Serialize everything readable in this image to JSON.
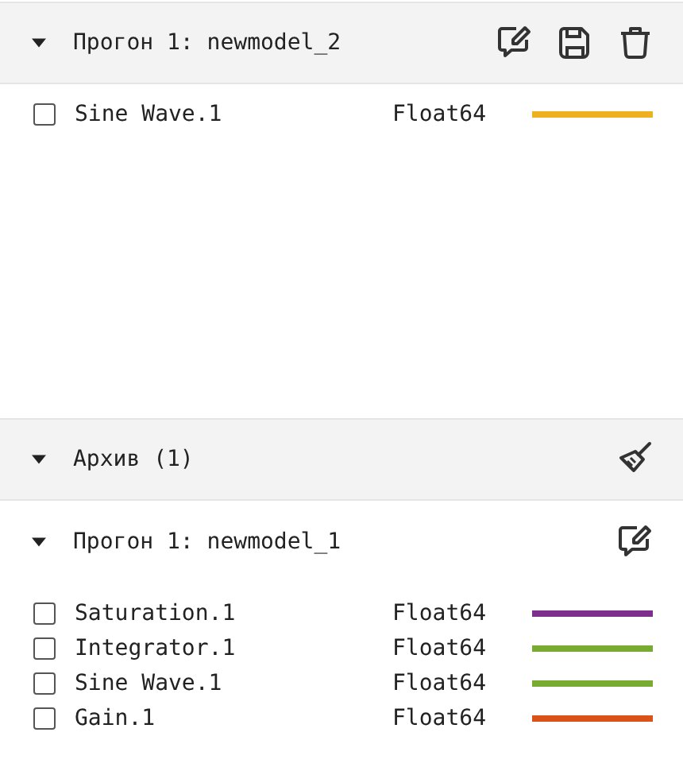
{
  "runs": [
    {
      "title": "Прогон 1: newmodel_2",
      "expanded": true,
      "actions": [
        {
          "kind": "rename"
        },
        {
          "kind": "save"
        },
        {
          "kind": "delete"
        }
      ],
      "signals": [
        {
          "name": "Sine Wave.1",
          "type": "Float64",
          "checked": false,
          "color": "#edb120"
        }
      ]
    }
  ],
  "archive": {
    "title": "Архив (1)",
    "expanded": true,
    "actions": [
      {
        "kind": "clear"
      }
    ],
    "runs": [
      {
        "title": "Прогон 1: newmodel_1",
        "expanded": true,
        "actions": [
          {
            "kind": "rename"
          }
        ],
        "signals": [
          {
            "name": "Saturation.1",
            "type": "Float64",
            "checked": false,
            "color": "#7e2f8e"
          },
          {
            "name": "Integrator.1",
            "type": "Float64",
            "checked": false,
            "color": "#77ac30"
          },
          {
            "name": "Sine Wave.1",
            "type": "Float64",
            "checked": false,
            "color": "#77ac30"
          },
          {
            "name": "Gain.1",
            "type": "Float64",
            "checked": false,
            "color": "#d95319"
          }
        ]
      }
    ]
  }
}
